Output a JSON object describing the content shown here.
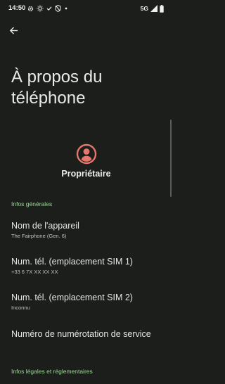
{
  "status_bar": {
    "time": "14:50",
    "network": "5G",
    "icons_left": [
      "settings-icon",
      "brightness-icon",
      "check-icon",
      "shield-icon",
      "dot-icon"
    ],
    "icons_right": [
      "signal-icon",
      "battery-icon"
    ]
  },
  "header": {
    "back_icon": "arrow-left-icon",
    "title": "À propos du téléphone"
  },
  "owner": {
    "avatar_icon": "account-circle-icon",
    "name": "Propriétaire",
    "accent_color": "#e5776d"
  },
  "sections": {
    "general": {
      "header": "Infos générales",
      "items": [
        {
          "title": "Nom de l'appareil",
          "summary": "The Fairphone (Gen. 6)"
        },
        {
          "title": "Num. tél. (emplacement SIM 1)",
          "summary": "+33 6 7X XX XX XX"
        },
        {
          "title": "Num. tél. (emplacement SIM 2)",
          "summary": "Inconnu"
        },
        {
          "title": "Numéro de numérotation de service",
          "summary": ""
        }
      ]
    },
    "legal": {
      "header": "Infos légales et réglementaires"
    }
  },
  "colors": {
    "background": "#1b1e1b",
    "section_header": "#9fd49a",
    "text_primary": "#e4e6e2",
    "text_secondary": "#c0c3bd"
  }
}
